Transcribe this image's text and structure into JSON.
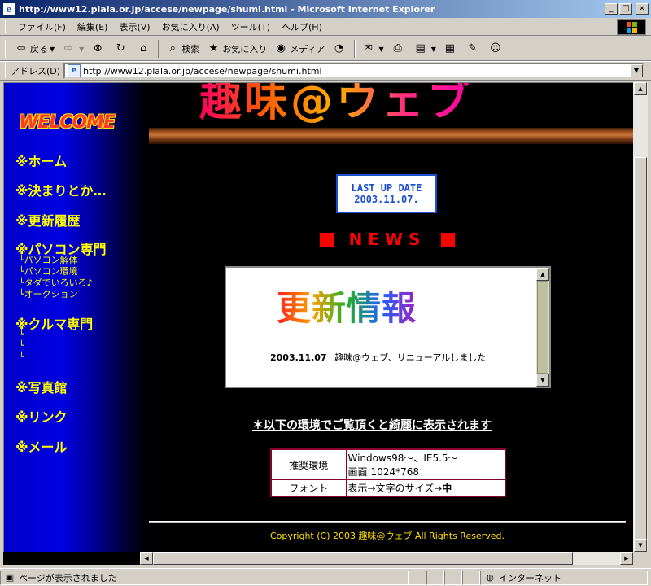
{
  "window": {
    "title": "http://www12.plala.or.jp/accese/newpage/shumi.html - Microsoft Internet Explorer",
    "icon": "ie-icon"
  },
  "menubar": {
    "items": [
      "ファイル(F)",
      "編集(E)",
      "表示(V)",
      "お気に入り(A)",
      "ツール(T)",
      "ヘルプ(H)"
    ]
  },
  "toolbar": {
    "back": "戻る",
    "search": "検索",
    "favorites": "お気に入り",
    "media": "メディア"
  },
  "addressbar": {
    "label": "アドレス(D)",
    "url": "http://www12.plala.or.jp/accese/newpage/shumi.html"
  },
  "page": {
    "banner_title": "趣味@ウェブ",
    "welcome": "WELCOME",
    "nav": {
      "home": "※ホーム",
      "rules": "※決まりとか…",
      "history": "※更新履歴",
      "pc": "※パソコン専門",
      "pc_subs": [
        "└パソコン解体",
        "└パソコン環境",
        "└タダでいろいろ♪",
        "└オークション"
      ],
      "car": "※クルマ専門",
      "car_subs": [
        "└",
        "└",
        "└"
      ],
      "photo": "※写真館",
      "link": "※リンク",
      "mail": "※メール"
    },
    "last_update": {
      "label": "LAST UP DATE",
      "date": "2003.11.07."
    },
    "news_heading": "NEWS",
    "news_box": {
      "heading": "更新情報",
      "entries": [
        {
          "date": "2003.11.07",
          "text": "趣味@ウェブ、リニューアルしました"
        }
      ]
    },
    "environment_note": "＊以下の環境でご覧頂くと綺麗に表示されます",
    "environment_table": {
      "recommended_label": "推奨環境",
      "recommended_value_line1": "Windows98～、IE5.5～",
      "recommended_value_line2": "画面:1024*768",
      "font_label": "フォント",
      "font_value": "表示→文字のサイズ→",
      "font_value_bold": "中"
    },
    "copyright": "Copyright (C) 2003 趣味@ウェブ All Rights Reserved."
  },
  "statusbar": {
    "message": "ページが表示されました",
    "zone": "インターネット"
  },
  "colors": {
    "nav_text": "#ffff00",
    "news_red": "#ff0000",
    "lastup_blue": "#1a4fd0",
    "table_border": "#8a0030",
    "titlebar": "#0a246a"
  }
}
